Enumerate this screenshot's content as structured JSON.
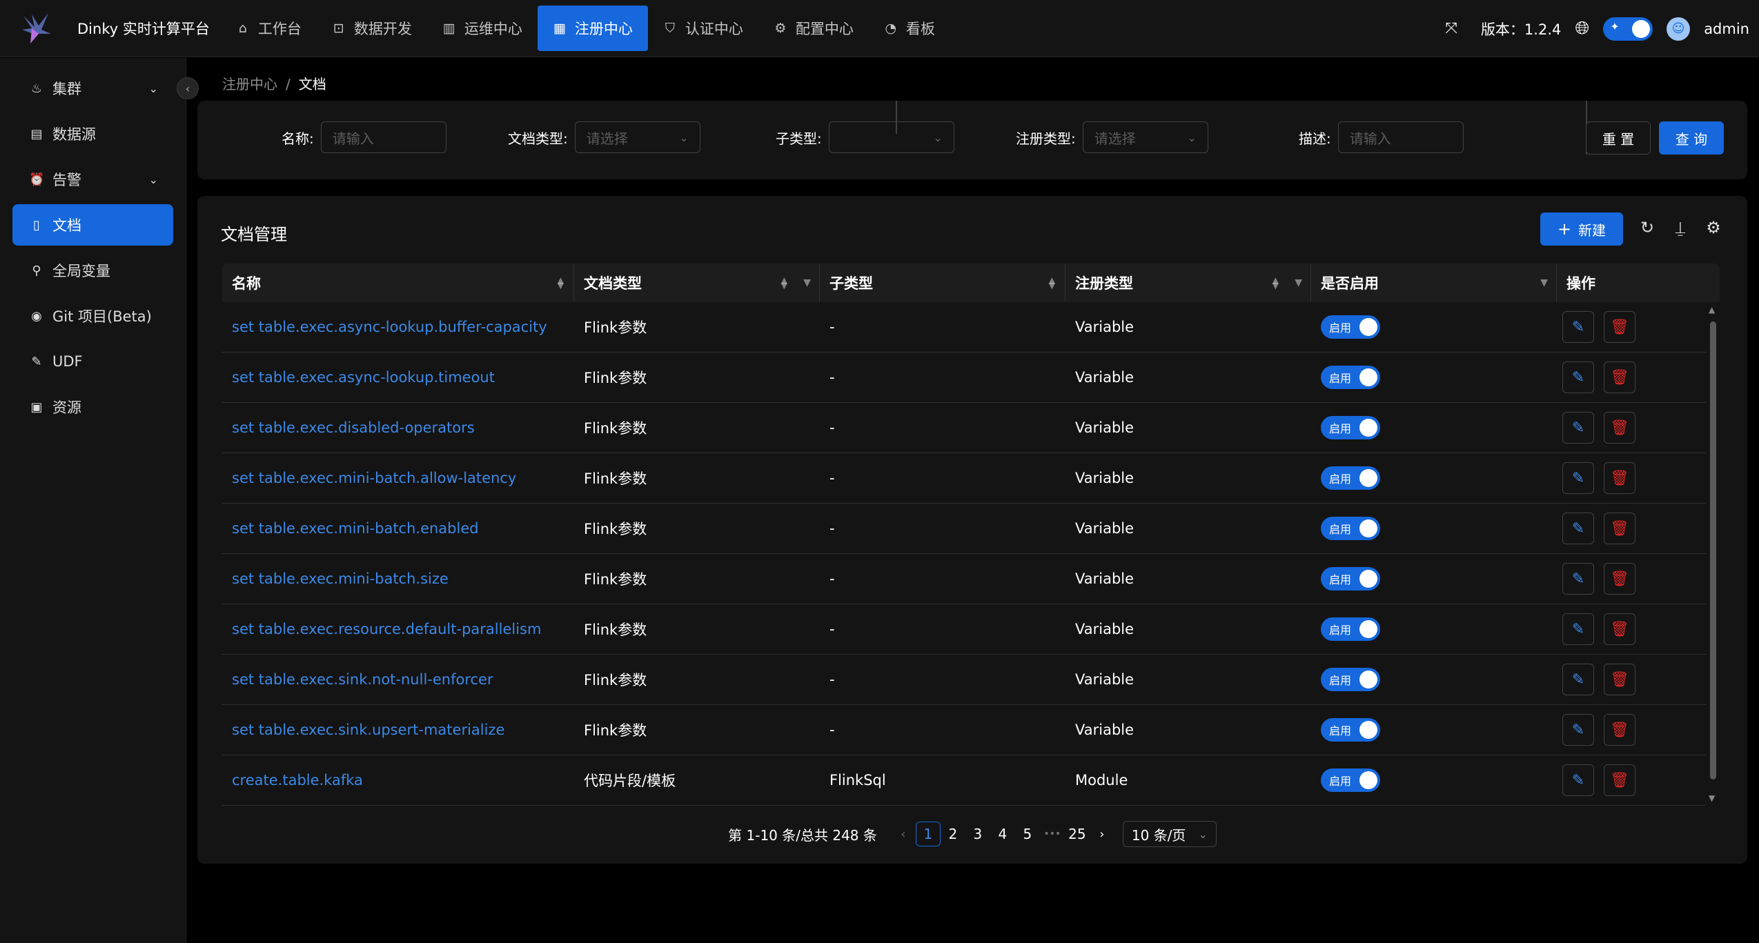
{
  "app": {
    "title": "Dinky 实时计算平台"
  },
  "topnav": {
    "items": [
      {
        "label": "工作台",
        "icon": "home-icon",
        "glyph": "⌂"
      },
      {
        "label": "数据开发",
        "icon": "terminal-icon",
        "glyph": "⊡"
      },
      {
        "label": "运维中心",
        "icon": "monitor-icon",
        "glyph": "▥"
      },
      {
        "label": "注册中心",
        "icon": "grid-icon",
        "glyph": "▦",
        "active": true
      },
      {
        "label": "认证中心",
        "icon": "shield-icon",
        "glyph": "⛉"
      },
      {
        "label": "配置中心",
        "icon": "gear-icon",
        "glyph": "⚙"
      },
      {
        "label": "看板",
        "icon": "dashboard-icon",
        "glyph": "◔"
      }
    ],
    "version": "版本：1.2.4",
    "user": "admin"
  },
  "sidebar": {
    "items": [
      {
        "label": "集群",
        "glyph": "♨",
        "icon": "cluster-icon",
        "chevron": true
      },
      {
        "label": "数据源",
        "glyph": "▤",
        "icon": "database-icon"
      },
      {
        "label": "告警",
        "glyph": "⏰",
        "icon": "alarm-icon",
        "chevron": true
      },
      {
        "label": "文档",
        "glyph": "▯",
        "icon": "document-icon",
        "active": true
      },
      {
        "label": "全局变量",
        "glyph": "⚲",
        "icon": "variable-icon"
      },
      {
        "label": "Git 项目(Beta)",
        "glyph": "◉",
        "icon": "github-icon"
      },
      {
        "label": "UDF",
        "glyph": "✎",
        "icon": "udf-icon"
      },
      {
        "label": "资源",
        "glyph": "▣",
        "icon": "resource-icon"
      }
    ]
  },
  "breadcrumb": {
    "parent": "注册中心",
    "current": "文档",
    "separator": "/"
  },
  "search": {
    "name_label": "名称:",
    "name_placeholder": "请输入",
    "doctype_label": "文档类型:",
    "doctype_placeholder": "请选择",
    "subtype_label": "子类型:",
    "subtype_placeholder": "",
    "regtype_label": "注册类型:",
    "regtype_placeholder": "请选择",
    "desc_label": "描述:",
    "desc_placeholder": "请输入",
    "reset": "重 置",
    "query": "查 询"
  },
  "table": {
    "title": "文档管理",
    "new_label": "新建",
    "columns": [
      "名称",
      "文档类型",
      "子类型",
      "注册类型",
      "是否启用",
      "操作"
    ],
    "switch_label": "启用",
    "rows": [
      {
        "name": "set table.exec.async-lookup.buffer-capacity",
        "doc_type": "Flink参数",
        "sub_type": "-",
        "reg_type": "Variable"
      },
      {
        "name": "set table.exec.async-lookup.timeout",
        "doc_type": "Flink参数",
        "sub_type": "-",
        "reg_type": "Variable"
      },
      {
        "name": "set table.exec.disabled-operators",
        "doc_type": "Flink参数",
        "sub_type": "-",
        "reg_type": "Variable"
      },
      {
        "name": "set table.exec.mini-batch.allow-latency",
        "doc_type": "Flink参数",
        "sub_type": "-",
        "reg_type": "Variable"
      },
      {
        "name": "set table.exec.mini-batch.enabled",
        "doc_type": "Flink参数",
        "sub_type": "-",
        "reg_type": "Variable"
      },
      {
        "name": "set table.exec.mini-batch.size",
        "doc_type": "Flink参数",
        "sub_type": "-",
        "reg_type": "Variable"
      },
      {
        "name": "set table.exec.resource.default-parallelism",
        "doc_type": "Flink参数",
        "sub_type": "-",
        "reg_type": "Variable"
      },
      {
        "name": "set table.exec.sink.not-null-enforcer",
        "doc_type": "Flink参数",
        "sub_type": "-",
        "reg_type": "Variable"
      },
      {
        "name": "set table.exec.sink.upsert-materialize",
        "doc_type": "Flink参数",
        "sub_type": "-",
        "reg_type": "Variable"
      },
      {
        "name": "create.table.kafka",
        "doc_type": "代码片段/模板",
        "sub_type": "FlinkSql",
        "reg_type": "Module"
      }
    ]
  },
  "pagination": {
    "summary": "第 1-10 条/总共 248 条",
    "pages": [
      "1",
      "2",
      "3",
      "4",
      "5",
      "•••",
      "25"
    ],
    "current": "1",
    "page_size": "10 条/页"
  },
  "colors": {
    "accent": "#1668dc",
    "link": "#3c89e8",
    "danger": "#e02424",
    "bg": "#000000",
    "panel": "#141414"
  }
}
